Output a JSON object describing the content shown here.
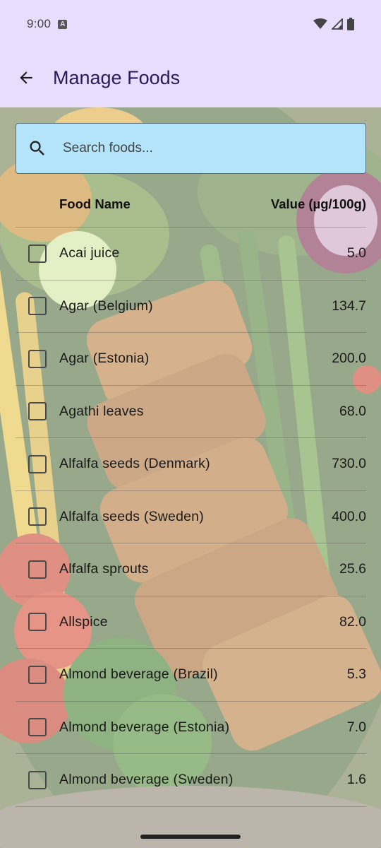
{
  "status_bar": {
    "time": "9:00",
    "badge": "A"
  },
  "app_bar": {
    "title": "Manage Foods"
  },
  "search": {
    "placeholder": "Search foods..."
  },
  "table": {
    "headers": {
      "name": "Food Name",
      "value": "Value (µg/100g)"
    },
    "rows": [
      {
        "name": "Acai juice",
        "value": "5.0"
      },
      {
        "name": "Agar (Belgium)",
        "value": "134.7"
      },
      {
        "name": "Agar (Estonia)",
        "value": "200.0"
      },
      {
        "name": "Agathi leaves",
        "value": "68.0"
      },
      {
        "name": "Alfalfa seeds (Denmark)",
        "value": "730.0"
      },
      {
        "name": "Alfalfa seeds (Sweden)",
        "value": "400.0"
      },
      {
        "name": "Alfalfa sprouts",
        "value": "25.6"
      },
      {
        "name": "Allspice",
        "value": "82.0"
      },
      {
        "name": "Almond beverage (Brazil)",
        "value": "5.3"
      },
      {
        "name": "Almond beverage (Estonia)",
        "value": "7.0"
      },
      {
        "name": "Almond beverage (Sweden)",
        "value": "1.6"
      }
    ]
  },
  "icons": {
    "back": "arrow-back-icon",
    "search": "search-icon",
    "wifi": "wifi-icon",
    "signal": "signal-icon",
    "battery": "battery-icon"
  },
  "colors": {
    "app_bar_bg": "#e9ddfd",
    "title_color": "#2a1a5e",
    "search_bg": "#b3e4fa"
  }
}
